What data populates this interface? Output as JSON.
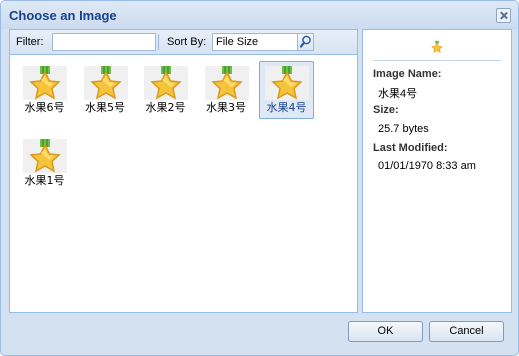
{
  "window": {
    "title": "Choose an Image"
  },
  "toolbar": {
    "filter_label": "Filter:",
    "filter_value": "",
    "sort_label": "Sort By:",
    "sort_value": "File Size"
  },
  "images": [
    {
      "label": "水果6号",
      "selected": false
    },
    {
      "label": "水果5号",
      "selected": false
    },
    {
      "label": "水果2号",
      "selected": false
    },
    {
      "label": "水果3号",
      "selected": false
    },
    {
      "label": "水果4号",
      "selected": true
    },
    {
      "label": "水果1号",
      "selected": false
    }
  ],
  "details": {
    "name_label": "Image Name:",
    "name_value": "水果4号",
    "size_label": "Size:",
    "size_value": "25.7 bytes",
    "modified_label": "Last Modified:",
    "modified_value": "01/01/1970 8:33 am"
  },
  "buttons": {
    "ok": "OK",
    "cancel": "Cancel"
  },
  "icons": {
    "close": "close-icon",
    "search": "search-icon",
    "image": "star-medal-icon"
  },
  "colors": {
    "title_text": "#15428b",
    "border": "#99bbe8",
    "window_bg": "#d3e1f1",
    "selection": "#dfe8f6"
  }
}
